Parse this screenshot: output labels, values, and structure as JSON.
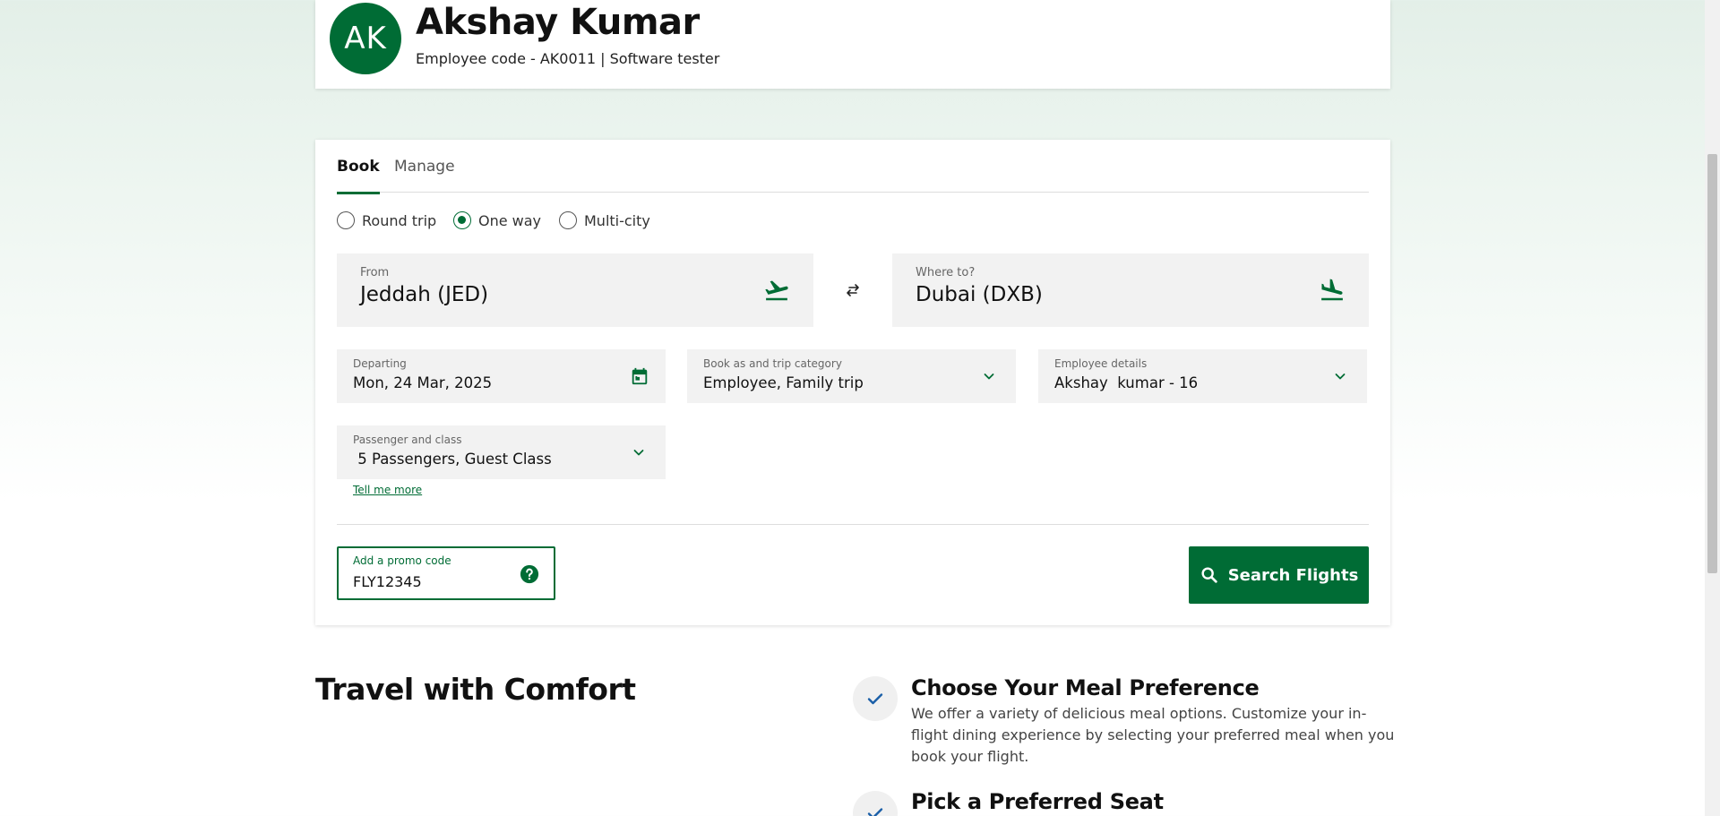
{
  "profile": {
    "initials": "AK",
    "name": "Akshay Kumar",
    "subtitle": "Employee code - AK0011 | Software tester"
  },
  "booking": {
    "tabs": [
      {
        "label": "Book",
        "active": true
      },
      {
        "label": "Manage",
        "active": false
      }
    ],
    "trip_types": [
      {
        "label": "Round trip",
        "checked": false
      },
      {
        "label": "One way",
        "checked": true
      },
      {
        "label": "Multi-city",
        "checked": false
      }
    ],
    "from": {
      "label": "From",
      "value": "Jeddah (JED)",
      "icon": "plane-takeoff-icon"
    },
    "to": {
      "label": "Where to?",
      "value": "Dubai (DXB)",
      "icon": "plane-landing-icon"
    },
    "swap_icon": "swap-arrows-icon",
    "departing": {
      "label": "Departing",
      "value": "Mon, 24 Mar, 2025",
      "icon": "calendar-icon"
    },
    "category": {
      "label": "Book as and trip category",
      "value": "Employee, Family trip"
    },
    "employee": {
      "label": "Employee details",
      "value": "Akshay  kumar - 16"
    },
    "passengers": {
      "label": "Passenger and class",
      "value": " 5 Passengers, Guest Class"
    },
    "tell_more": "Tell me more",
    "promo": {
      "label": "Add a promo code",
      "value": "FLY12345",
      "icon": "help-icon"
    },
    "search_button": "Search Flights"
  },
  "comfort": {
    "title": "Travel with Comfort",
    "features": [
      {
        "title": "Choose Your Meal Preference",
        "description": "We offer a variety of delicious meal options. Customize your in-flight dining experience by selecting your preferred meal when you book your flight."
      },
      {
        "title": "Pick a Preferred Seat",
        "description": ""
      }
    ]
  },
  "colors": {
    "brand": "#006c35",
    "field_bg": "#f2f2f2",
    "check": "#1a5fa8"
  }
}
